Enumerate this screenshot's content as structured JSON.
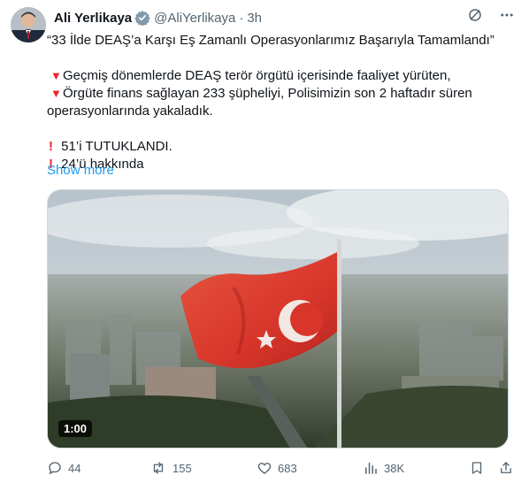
{
  "author": {
    "name": "Ali Yerlikaya",
    "handle": "@AliYerlikaya",
    "separator": "·",
    "time": "3h"
  },
  "icons": {
    "verified": "verified-badge-icon",
    "grok": "grok-icon",
    "more": "more-icon",
    "bullet_red": "red-triangle-down-icon",
    "exclamation": "red-exclamation-icon"
  },
  "colors": {
    "accent": "#1d9bf0",
    "text": "#0f1419",
    "muted": "#536471",
    "red": "#f4212e"
  },
  "tweet": {
    "title_line": "“33 İlde DEAŞ’a Karşı Eş Zamanlı Operasyonlarımız Başarıyla Tamamlandı”",
    "bullet_1": "Geçmiş dönemlerde DEAŞ terör örgütü içerisinde faaliyet yürüten,",
    "bullet_2_a": "Örgüte finans sağlayan 233 şüpheliyi, Polisimizin son 2 haftadır süren",
    "bullet_2_b": "operasyonlarında yakaladık.",
    "item_1": "51’i TUTUKLANDI.",
    "item_2": "24’ü hakkında",
    "show_more": "Show more"
  },
  "media": {
    "duration": "1:00"
  },
  "actions": {
    "replies": "44",
    "reposts": "155",
    "likes": "683",
    "views": "38K"
  }
}
